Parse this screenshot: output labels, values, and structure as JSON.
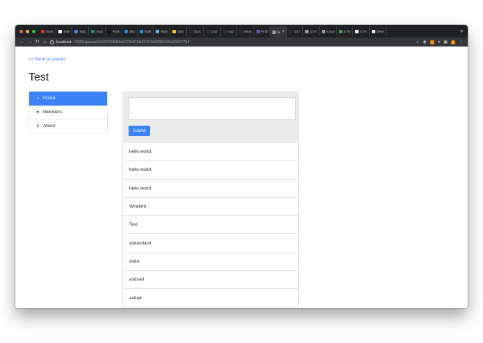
{
  "browser": {
    "tabs": [
      {
        "label": "Surfs",
        "color": "#e53935",
        "active": false
      },
      {
        "label": "Toke",
        "color": "#ffffff",
        "active": false
      },
      {
        "label": "BigC",
        "color": "#4285f4",
        "active": false
      },
      {
        "label": "Anal",
        "color": "#0f9d58",
        "active": false
      },
      {
        "label": "Pock",
        "color": "#111111",
        "active": false
      },
      {
        "label": "3Bo",
        "color": "#1e88e5",
        "active": false
      },
      {
        "label": "Notif",
        "color": "#1da1f2",
        "active": false
      },
      {
        "label": "https",
        "color": "#4fc3f7",
        "active": false
      },
      {
        "label": "Dirty",
        "color": "#fbc02d",
        "active": false
      },
      {
        "label": "3box",
        "color": "#2c2c2c",
        "active": false
      },
      {
        "label": "Choc",
        "color": "#2c2c2c",
        "active": false
      },
      {
        "label": "Auth",
        "color": "#2c2c2c",
        "active": false
      },
      {
        "label": "Mess",
        "color": "#2c2c2c",
        "active": false
      },
      {
        "label": "Profi",
        "color": "#7e57c2",
        "active": false
      },
      {
        "label": "lo",
        "color": "#9e9e9e",
        "active": true
      },
      {
        "label": "GET",
        "color": "#2c2c2c",
        "active": false
      },
      {
        "label": "ETH",
        "color": "#9e9e9e",
        "active": false
      },
      {
        "label": "Know",
        "color": "#9e9e9e",
        "active": false
      },
      {
        "label": "ETH",
        "color": "#43a047",
        "active": false
      },
      {
        "label": "ETH",
        "color": "#eeeeee",
        "active": false
      },
      {
        "label": "Deve",
        "color": "#eeeeee",
        "active": false
      }
    ],
    "url_host": "localhost",
    "url_path": ":3000/spaces/0x92576d68AA2C9b87bB6C876b825E629c9001F754"
  },
  "page": {
    "back_link": "<< Back to spaces",
    "title": "Test",
    "nav": [
      {
        "label": "Home",
        "icon": "home-icon",
        "active": true
      },
      {
        "label": "Members",
        "icon": "user-icon",
        "active": false
      },
      {
        "label": "About",
        "icon": "info-icon",
        "active": false
      }
    ],
    "composer": {
      "placeholder": "",
      "submit_label": "Submit"
    },
    "posts": [
      "hello world",
      "hello world",
      "hello world",
      "Whatttttt",
      "Test",
      "asdasdasd",
      "asda",
      "asdsad",
      "asdad"
    ]
  },
  "colors": {
    "accent": "#3b82f6",
    "tab_strip": "#202124",
    "toolbar": "#35363a",
    "composer_bg": "#ebebeb"
  }
}
